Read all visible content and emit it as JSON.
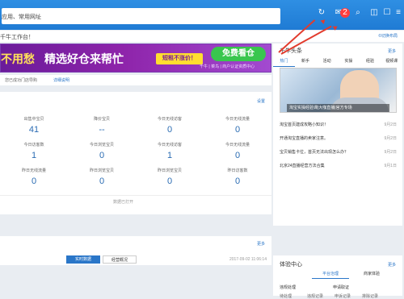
{
  "topbar": {
    "title": "应用、常用网址",
    "icons": [
      "refresh-icon",
      "mail-icon",
      "pin-icon",
      "skin-icon",
      "gift-icon",
      "menu-icon"
    ],
    "badge": "2"
  },
  "welcome": "千牛工作台！",
  "banner": {
    "left": "不用愁",
    "main": "精选好仓来帮忙",
    "pill": "短租不涨价！",
    "button": "免费看仓",
    "sub": "千牛 | 菜鸟 | 商户认证资质中心"
  },
  "notice": {
    "text": "您已成功门店导购",
    "link": "详细说明"
  },
  "stats": {
    "set_label": "设置",
    "items": [
      {
        "label": "出售中宝贝",
        "value": "41"
      },
      {
        "label": "降价宝贝",
        "value": "--"
      },
      {
        "label": "今日无线访客",
        "value": "0"
      },
      {
        "label": "今日无线流量",
        "value": "0"
      },
      {
        "label": "今日访客数",
        "value": "1"
      },
      {
        "label": "今日浏览宝贝",
        "value": "0"
      },
      {
        "label": "今日无线访客",
        "value": "1"
      },
      {
        "label": "今日无线流量",
        "value": "0"
      },
      {
        "label": "昨日无线流量",
        "value": "0"
      },
      {
        "label": "昨日浏览宝贝",
        "value": "0"
      },
      {
        "label": "昨日浏览宝贝",
        "value": "0"
      },
      {
        "label": "昨日访客数",
        "value": "0"
      }
    ],
    "footer": "数据已打开"
  },
  "bottom": {
    "more": "更多",
    "tab1": "实时数据",
    "tab2": "经营概况",
    "timestamp": "2017-09-02 11:06:14"
  },
  "right": {
    "top_link": "©切换布局",
    "card1": {
      "title": "千牛头条",
      "more": "更多",
      "tabs": [
        "热门",
        "新手",
        "活动",
        "实操",
        "经验",
        "视频课"
      ],
      "caption": "淘宝实操经验课|大咖直播|官方专场",
      "news": [
        {
          "text": "淘宝首页建成攻略小知识！",
          "date": "9月2日"
        },
        {
          "text": "开通淘宝直播的卖家注意。",
          "date": "9月2日"
        },
        {
          "text": "宝贝销售卡位，首页无法出现怎么办？",
          "date": "9月2日"
        },
        {
          "text": "北京24直播经营方法合集",
          "date": "9月1日"
        }
      ]
    },
    "card2": {
      "title": "体验中心",
      "more": "更多",
      "tab1": "平台治理",
      "tab2": "商家体验",
      "rows": [
        "违规处理",
        "申请取证"
      ],
      "subrows": [
        "待处理",
        "违规记录",
        "申诉记录",
        "排除记录"
      ]
    }
  }
}
